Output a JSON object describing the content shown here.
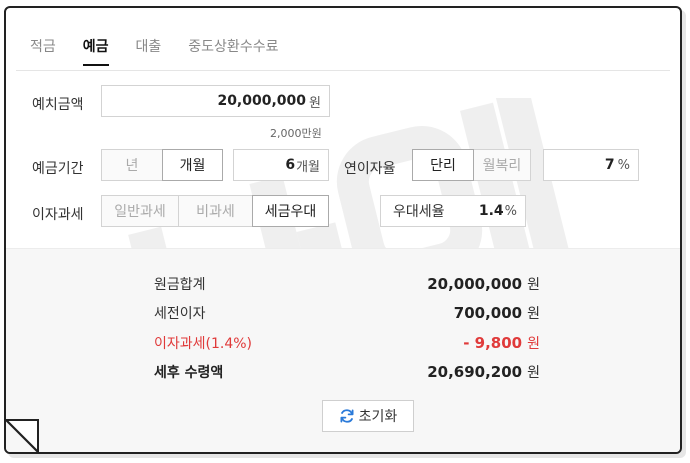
{
  "tabs": [
    "적금",
    "예금",
    "대출",
    "중도상환수수료"
  ],
  "active_tab": "예금",
  "form": {
    "deposit_label": "예치금액",
    "deposit_value": "20,000,000",
    "deposit_unit": "원",
    "deposit_hint": "2,000만원",
    "period_label": "예금기간",
    "period_units": [
      "년",
      "개월"
    ],
    "period_value": "6",
    "period_value_unit": "개월",
    "rate_label": "연이자율",
    "rate_types": [
      "단리",
      "월복리"
    ],
    "rate_value": "7",
    "rate_unit": "%",
    "tax_label": "이자과세",
    "tax_types": [
      "일반과세",
      "비과세",
      "세금우대"
    ],
    "pref_tax_label": "우대세율",
    "pref_tax_value": "1.4",
    "pref_tax_unit": "%"
  },
  "results": {
    "principal_label": "원금합계",
    "principal_value": "20,000,000",
    "pretax_label": "세전이자",
    "pretax_value": "700,000",
    "tax_label": "이자과세(1.4%)",
    "tax_value": "- 9,800",
    "net_label": "세후 수령액",
    "net_value": "20,690,200",
    "currency": "원"
  },
  "reset_label": "초기화",
  "watermark": "나이틴",
  "icons": {
    "reset": "refresh-icon"
  }
}
